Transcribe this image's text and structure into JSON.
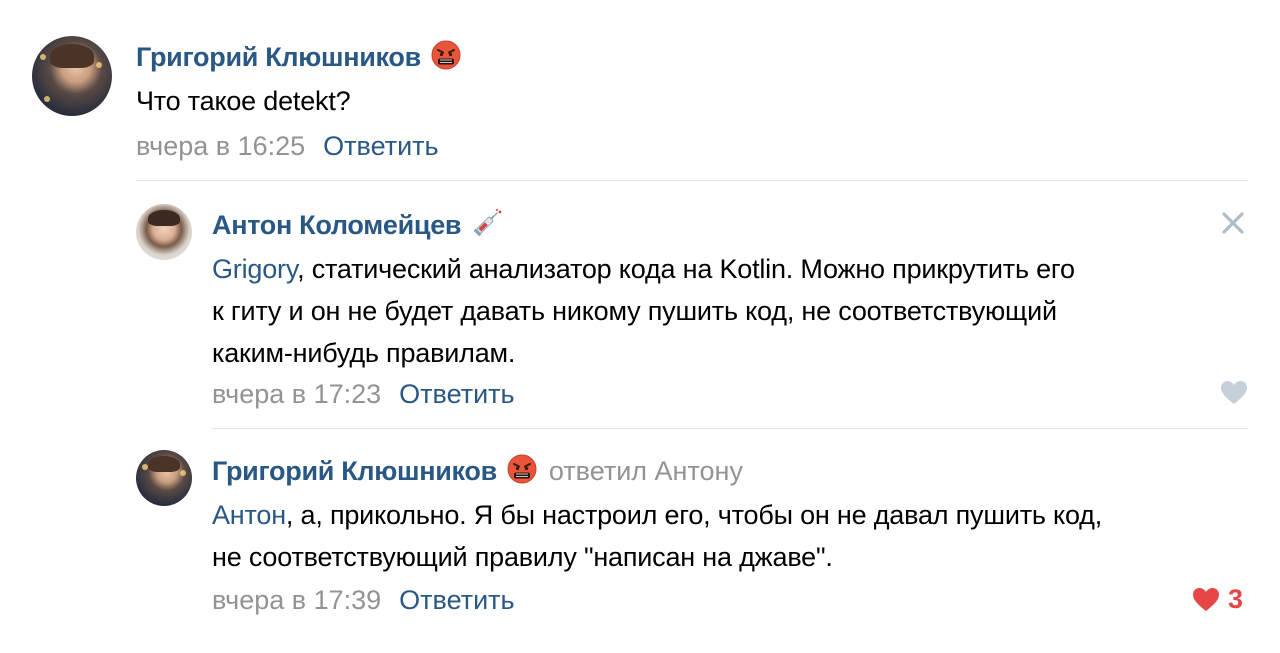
{
  "comments": [
    {
      "author": "Григорий Клюшников",
      "emoji_icon": "angry-face-icon",
      "text": "Что такое detekt?",
      "time": "вчера в 16:25",
      "reply_label": "Ответить"
    },
    {
      "author": "Антон Коломейцев",
      "emoji_icon": "syringe-icon",
      "mention": "Grigory",
      "text_line1": ", статический анализатор кода на Kotlin. Можно прикрутить его",
      "text_line2": "к гиту и он не будет давать никому пушить код, не соответствующий",
      "text_line3": "каким-нибудь правилам.",
      "time": "вчера в 17:23",
      "reply_label": "Ответить",
      "liked": false
    },
    {
      "author": "Григорий Клюшников",
      "emoji_icon": "angry-face-icon",
      "replied_to": "ответил Антону",
      "mention": "Антон",
      "text_line1": ", а, прикольно. Я бы настроил его, чтобы он не давал пушить код,",
      "text_line2": "не соответствующий правилу \"написан на джаве\".",
      "time": "вчера в 17:39",
      "reply_label": "Ответить",
      "liked": true,
      "likes": "3"
    }
  ],
  "colors": {
    "link": "#2a5885",
    "muted": "#939393",
    "like": "#e64646",
    "divider": "#e4e6ea"
  }
}
